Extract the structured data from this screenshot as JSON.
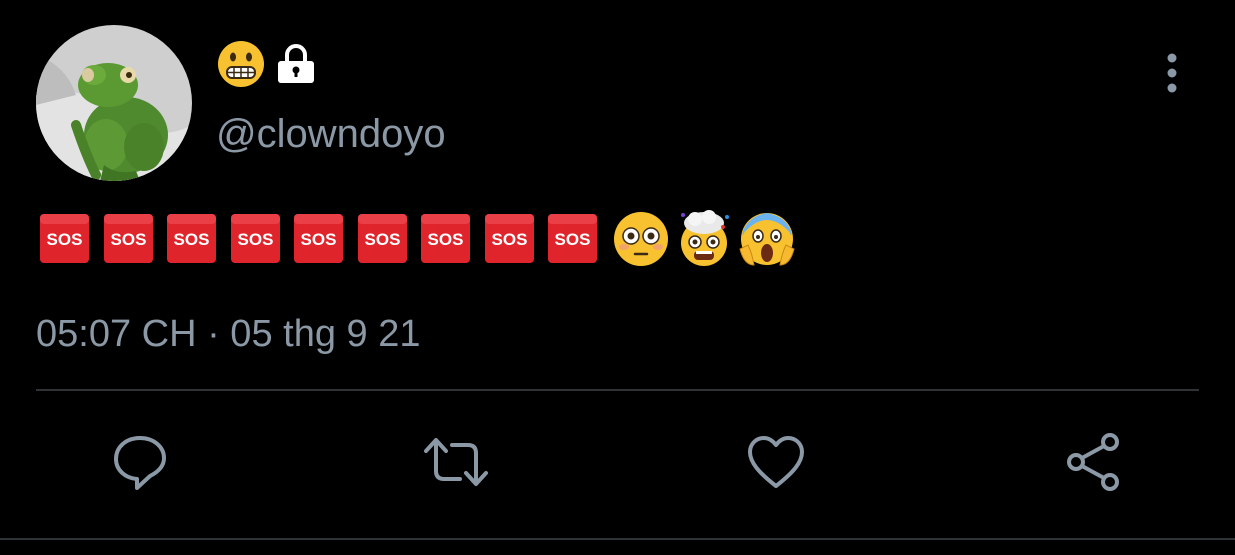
{
  "tweet": {
    "user": {
      "handle": "@clowndoyo",
      "display_name_icons": [
        "grimacing-face-emoji",
        "lock-icon"
      ],
      "avatar": "green-frog-plush-avatar"
    },
    "text_emojis": [
      "sos",
      "sos",
      "sos",
      "sos",
      "sos",
      "sos",
      "sos",
      "sos",
      "sos",
      "flushed-face",
      "exploding-head",
      "face-screaming-in-fear"
    ],
    "timestamp": "05:07 CH · 05 thg 9 21",
    "actions": [
      {
        "name": "reply",
        "icon": "speech-bubble-icon"
      },
      {
        "name": "retweet",
        "icon": "retweet-icon"
      },
      {
        "name": "like",
        "icon": "heart-icon"
      },
      {
        "name": "share",
        "icon": "share-icon"
      }
    ]
  },
  "colors": {
    "background": "#000000",
    "secondary_text": "#8b98a5",
    "divider": "#2f3336",
    "sos_red": "#e0242c",
    "emoji_yellow": "#f7c12f"
  }
}
